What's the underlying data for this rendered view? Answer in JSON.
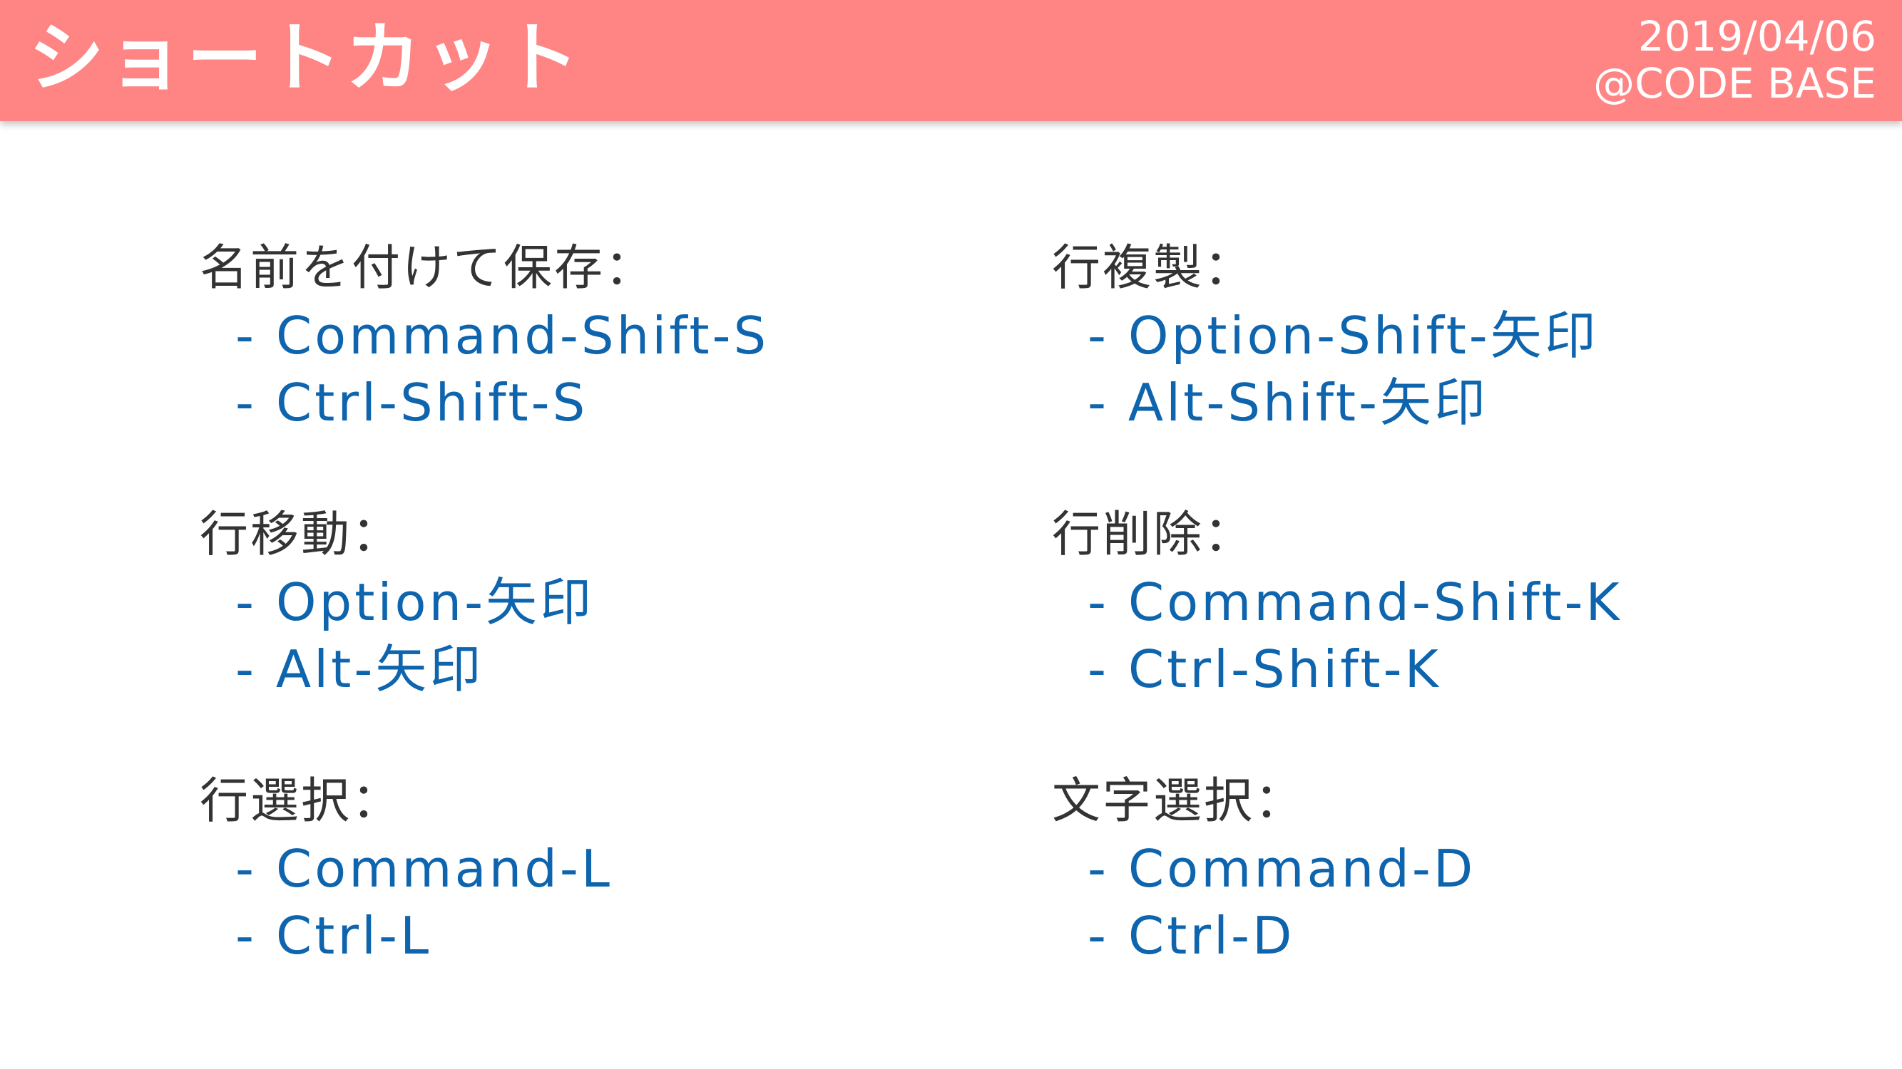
{
  "header": {
    "title": "ショートカット",
    "date": "2019/04/06",
    "brand": "@CODE BASE"
  },
  "left_column": [
    {
      "heading": "名前を付けて保存：",
      "items": [
        "- Command-Shift-S",
        "- Ctrl-Shift-S"
      ]
    },
    {
      "heading": "行移動：",
      "items": [
        "- Option-矢印",
        "- Alt-矢印"
      ]
    },
    {
      "heading": "行選択：",
      "items": [
        "- Command-L",
        "- Ctrl-L"
      ]
    }
  ],
  "right_column": [
    {
      "heading": "行複製：",
      "items": [
        "- Option-Shift-矢印",
        "- Alt-Shift-矢印"
      ]
    },
    {
      "heading": "行削除：",
      "items": [
        "- Command-Shift-K",
        "- Ctrl-Shift-K"
      ]
    },
    {
      "heading": "文字選択：",
      "items": [
        "- Command-D",
        "- Ctrl-D"
      ]
    }
  ],
  "colors": {
    "header_bg": "#ff8585",
    "heading_text": "#333333",
    "shortcut_text": "#0e64ad"
  }
}
